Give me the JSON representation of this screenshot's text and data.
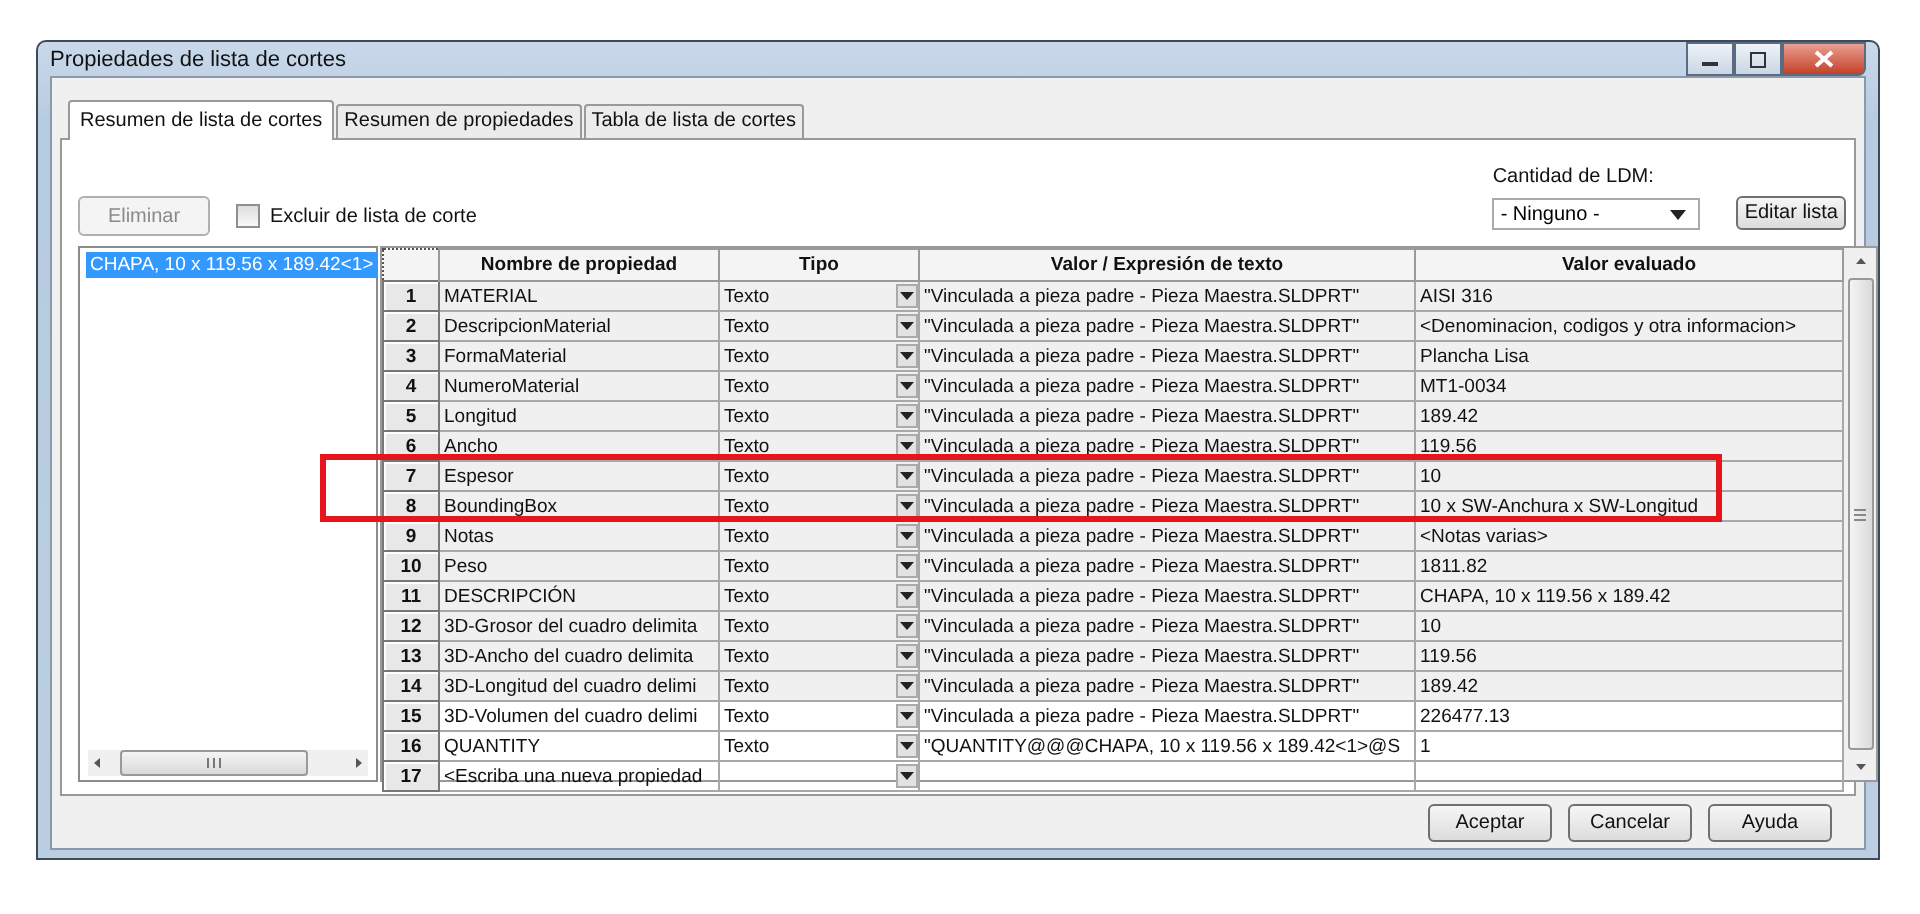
{
  "window": {
    "title": "Propiedades de lista de cortes"
  },
  "tabs": [
    {
      "label": "Resumen de lista de cortes",
      "selected": true
    },
    {
      "label": "Resumen de propiedades",
      "selected": false
    },
    {
      "label": "Tabla de lista de cortes",
      "selected": false
    }
  ],
  "delete_button": {
    "label": "Eliminar",
    "disabled": true
  },
  "exclude_checkbox": {
    "label": "Excluir de lista de corte",
    "checked": false
  },
  "bom_quantity": {
    "label": "Cantidad de LDM:",
    "value": "- Ninguno -"
  },
  "edit_list_button": "Editar lista",
  "tree": {
    "items": [
      {
        "label": "CHAPA, 10 x 119.56 x 189.42<1>",
        "selected": true
      }
    ]
  },
  "table": {
    "columns": [
      "Nombre de propiedad",
      "Tipo",
      "Valor / Expresión de texto",
      "Valor evaluado"
    ],
    "rows": [
      {
        "number": "1",
        "name": "MATERIAL",
        "type": "Texto",
        "expression": "\"Vinculada a pieza padre - Pieza Maestra.SLDPRT\"",
        "evaluated": "AISI 316",
        "linked": true,
        "highlighted": false
      },
      {
        "number": "2",
        "name": "DescripcionMaterial",
        "type": "Texto",
        "expression": "\"Vinculada a pieza padre - Pieza Maestra.SLDPRT\"",
        "evaluated": "<Denominacion, codigos y otra informacion>",
        "linked": true,
        "highlighted": false
      },
      {
        "number": "3",
        "name": "FormaMaterial",
        "type": "Texto",
        "expression": "\"Vinculada a pieza padre - Pieza Maestra.SLDPRT\"",
        "evaluated": "Plancha Lisa",
        "linked": true,
        "highlighted": false
      },
      {
        "number": "4",
        "name": "NumeroMaterial",
        "type": "Texto",
        "expression": "\"Vinculada a pieza padre - Pieza Maestra.SLDPRT\"",
        "evaluated": "MT1-0034",
        "linked": true,
        "highlighted": false
      },
      {
        "number": "5",
        "name": "Longitud",
        "type": "Texto",
        "expression": "\"Vinculada a pieza padre - Pieza Maestra.SLDPRT\"",
        "evaluated": "189.42",
        "linked": true,
        "highlighted": false
      },
      {
        "number": "6",
        "name": "Ancho",
        "type": "Texto",
        "expression": "\"Vinculada a pieza padre - Pieza Maestra.SLDPRT\"",
        "evaluated": "119.56",
        "linked": true,
        "highlighted": false
      },
      {
        "number": "7",
        "name": "Espesor",
        "type": "Texto",
        "expression": "\"Vinculada a pieza padre - Pieza Maestra.SLDPRT\"",
        "evaluated": "10",
        "linked": true,
        "highlighted": true
      },
      {
        "number": "8",
        "name": "BoundingBox",
        "type": "Texto",
        "expression": "\"Vinculada a pieza padre - Pieza Maestra.SLDPRT\"",
        "evaluated": "10 x SW-Anchura x SW-Longitud",
        "linked": true,
        "highlighted": true
      },
      {
        "number": "9",
        "name": "Notas",
        "type": "Texto",
        "expression": "\"Vinculada a pieza padre - Pieza Maestra.SLDPRT\"",
        "evaluated": "<Notas varias>",
        "linked": true,
        "highlighted": false
      },
      {
        "number": "10",
        "name": "Peso",
        "type": "Texto",
        "expression": "\"Vinculada a pieza padre - Pieza Maestra.SLDPRT\"",
        "evaluated": "1811.82",
        "linked": true,
        "highlighted": false
      },
      {
        "number": "11",
        "name": "DESCRIPCIÓN",
        "type": "Texto",
        "expression": "\"Vinculada a pieza padre - Pieza Maestra.SLDPRT\"",
        "evaluated": "CHAPA, 10 x 119.56 x 189.42",
        "linked": true,
        "highlighted": false
      },
      {
        "number": "12",
        "name": "3D-Grosor del cuadro delimita",
        "type": "Texto",
        "expression": "\"Vinculada a pieza padre - Pieza Maestra.SLDPRT\"",
        "evaluated": "10",
        "linked": true,
        "highlighted": false
      },
      {
        "number": "13",
        "name": "3D-Ancho del cuadro delimita",
        "type": "Texto",
        "expression": "\"Vinculada a pieza padre - Pieza Maestra.SLDPRT\"",
        "evaluated": "119.56",
        "linked": true,
        "highlighted": false
      },
      {
        "number": "14",
        "name": "3D-Longitud del cuadro delimi",
        "type": "Texto",
        "expression": "\"Vinculada a pieza padre - Pieza Maestra.SLDPRT\"",
        "evaluated": "189.42",
        "linked": true,
        "highlighted": false
      },
      {
        "number": "15",
        "name": "3D-Volumen del cuadro delimi",
        "type": "Texto",
        "expression": "\"Vinculada a pieza padre - Pieza Maestra.SLDPRT\"",
        "evaluated": "226477.13",
        "linked": false,
        "highlighted": false
      },
      {
        "number": "16",
        "name": "QUANTITY",
        "type": "Texto",
        "expression": "\"QUANTITY@@@CHAPA, 10 x 119.56 x 189.42<1>@S",
        "evaluated": "1",
        "linked": false,
        "highlighted": false
      },
      {
        "number": "17",
        "name": "<Escriba una nueva propiedad",
        "linked": false,
        "highlighted": false
      }
    ]
  },
  "annotation": {
    "color": "#e8141c"
  },
  "buttons": [
    "Aceptar",
    "Cancelar",
    "Ayuda"
  ]
}
